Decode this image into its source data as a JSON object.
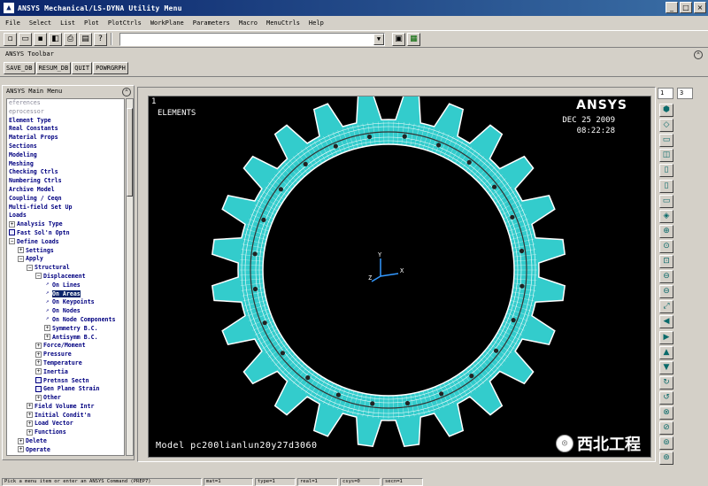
{
  "window": {
    "title": "ANSYS Mechanical/LS-DYNA Utility Menu"
  },
  "menubar": [
    "File",
    "Select",
    "List",
    "Plot",
    "PlotCtrls",
    "WorkPlane",
    "Parameters",
    "Macro",
    "MenuCtrls",
    "Help"
  ],
  "toolbar_icons": [
    "new-file",
    "open",
    "save",
    "save-db",
    "print",
    "report",
    "help"
  ],
  "ansys_toolbar": {
    "title": "ANSYS Toolbar",
    "buttons": [
      "SAVE_DB",
      "RESUM_DB",
      "QUIT",
      "POWRGRPH"
    ]
  },
  "main_menu": {
    "title": "ANSYS Main Menu",
    "items": [
      {
        "label": "eferences",
        "indent": 0,
        "icon": "",
        "faded": true
      },
      {
        "label": "eprocessor",
        "indent": 0,
        "icon": "",
        "faded": true
      },
      {
        "label": "Element Type",
        "indent": 0,
        "icon": ""
      },
      {
        "label": "Real Constants",
        "indent": 0,
        "icon": ""
      },
      {
        "label": "Material Props",
        "indent": 0,
        "icon": ""
      },
      {
        "label": "Sections",
        "indent": 0,
        "icon": ""
      },
      {
        "label": "Modeling",
        "indent": 0,
        "icon": ""
      },
      {
        "label": "Meshing",
        "indent": 0,
        "icon": ""
      },
      {
        "label": "Checking Ctrls",
        "indent": 0,
        "icon": ""
      },
      {
        "label": "Numbering Ctrls",
        "indent": 0,
        "icon": ""
      },
      {
        "label": "Archive Model",
        "indent": 0,
        "icon": ""
      },
      {
        "label": "Coupling / Ceqn",
        "indent": 0,
        "icon": ""
      },
      {
        "label": "Multi-field Set Up",
        "indent": 0,
        "icon": ""
      },
      {
        "label": "Loads",
        "indent": 0,
        "icon": ""
      },
      {
        "label": "Analysis Type",
        "indent": 0,
        "icon": "+"
      },
      {
        "label": "Fast Sol'n Optn",
        "indent": 0,
        "icon": "doc"
      },
      {
        "label": "Define Loads",
        "indent": 0,
        "icon": "-"
      },
      {
        "label": "Settings",
        "indent": 1,
        "icon": "+"
      },
      {
        "label": "Apply",
        "indent": 1,
        "icon": "-"
      },
      {
        "label": "Structural",
        "indent": 2,
        "icon": "-"
      },
      {
        "label": "Displacement",
        "indent": 3,
        "icon": "-"
      },
      {
        "label": "On Lines",
        "indent": 4,
        "icon": "arrow"
      },
      {
        "label": "On Areas",
        "indent": 4,
        "icon": "arrow",
        "selected": true
      },
      {
        "label": "On Keypoints",
        "indent": 4,
        "icon": "arrow"
      },
      {
        "label": "On Nodes",
        "indent": 4,
        "icon": "arrow"
      },
      {
        "label": "On Node Components",
        "indent": 4,
        "icon": "arrow"
      },
      {
        "label": "Symmetry B.C.",
        "indent": 4,
        "icon": "+"
      },
      {
        "label": "Antisymm B.C.",
        "indent": 4,
        "icon": "+"
      },
      {
        "label": "Force/Moment",
        "indent": 3,
        "icon": "+"
      },
      {
        "label": "Pressure",
        "indent": 3,
        "icon": "+"
      },
      {
        "label": "Temperature",
        "indent": 3,
        "icon": "+"
      },
      {
        "label": "Inertia",
        "indent": 3,
        "icon": "+"
      },
      {
        "label": "Pretnsn Sectn",
        "indent": 3,
        "icon": "doc"
      },
      {
        "label": "Gen Plane Strain",
        "indent": 3,
        "icon": "doc"
      },
      {
        "label": "Other",
        "indent": 3,
        "icon": "+"
      },
      {
        "label": "Field Volume Intr",
        "indent": 2,
        "icon": "+"
      },
      {
        "label": "Initial Condit'n",
        "indent": 2,
        "icon": "+"
      },
      {
        "label": "Load Vector",
        "indent": 2,
        "icon": "+"
      },
      {
        "label": "Functions",
        "indent": 2,
        "icon": "+"
      },
      {
        "label": "Delete",
        "indent": 1,
        "icon": "+"
      },
      {
        "label": "Operate",
        "indent": 1,
        "icon": "+"
      }
    ]
  },
  "graphics": {
    "window_number": "1",
    "plot_type": "ELEMENTS",
    "logo": "ANSYS",
    "date": "DEC 25 2009",
    "time": "08:22:28",
    "model_label": "Model pc200lianlun20y27d3060",
    "axis_labels": [
      "Y",
      "Z",
      "X"
    ],
    "colors": {
      "background": "#000000",
      "mesh": "#33cccc",
      "mesh_line": "#ffffff"
    },
    "gear": {
      "teeth": 24
    }
  },
  "right_toolbar": {
    "window_select": "1",
    "view_select": "3",
    "icons": [
      "iso-view",
      "front-view",
      "top-view",
      "back-view",
      "right-view",
      "left-view",
      "bottom-view",
      "oblique-view",
      "zoom-in",
      "zoom",
      "box-zoom",
      "zoom-back",
      "zoom-out",
      "fit",
      "pan-left",
      "pan-right",
      "pan-up",
      "pan-down",
      "rotate-cw",
      "rotate-ccw",
      "rotate-x",
      "rotate-y",
      "rotate-z",
      "dynamic-mode"
    ]
  },
  "status_bar": {
    "prompt": "Pick a menu item or enter an ANSYS Command (PREP7)",
    "cells": [
      "mat=1",
      "type=1",
      "real=1",
      "csys=0",
      "secn=1"
    ]
  },
  "watermark": {
    "text": "西北工程"
  }
}
